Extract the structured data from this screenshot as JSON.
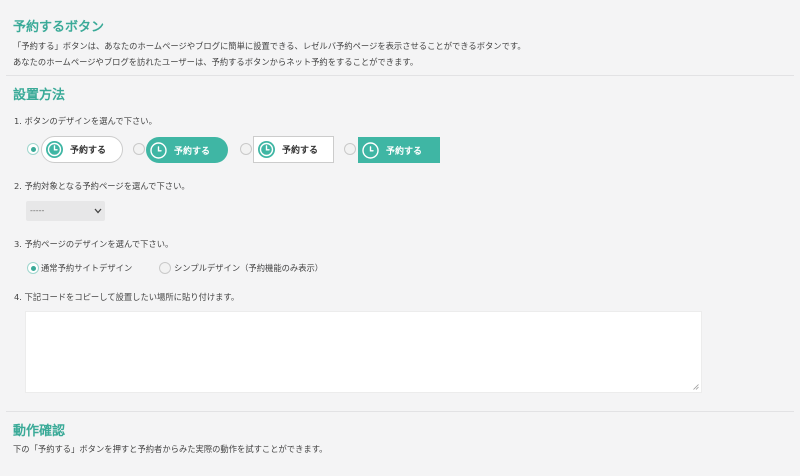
{
  "section1": {
    "title": "予約するボタン",
    "line1": "「予約する」ボタンは、あなたのホームページやブログに簡単に設置できる、レゼルバ予約ページを表示させることができるボタンです。",
    "line2": "あなたのホームページやブログを訪れたユーザーは、予約するボタンからネット予約をすることができます。"
  },
  "section2": {
    "title": "設置方法",
    "step1": "1. ボタンのデザインを選んで下さい。",
    "button_label": "予約する",
    "step2": "2. 予約対象となる予約ページを選んで下さい。",
    "select_value": "-----",
    "step3": "3. 予約ページのデザインを選んで下さい。",
    "design_option1": "通常予約サイトデザイン",
    "design_option2": "シンプルデザイン（予約機能のみ表示）",
    "step4": "4. 下記コードをコピーして設置したい場所に貼り付けます。",
    "code_value": ""
  },
  "section3": {
    "title": "動作確認",
    "line1": "下の「予約する」ボタンを押すと予約者からみた実際の動作を試すことができます。"
  },
  "colors": {
    "accent": "#3aaa98",
    "button_fill": "#3fb6a4"
  },
  "icons": {
    "clock": "clock-icon"
  }
}
